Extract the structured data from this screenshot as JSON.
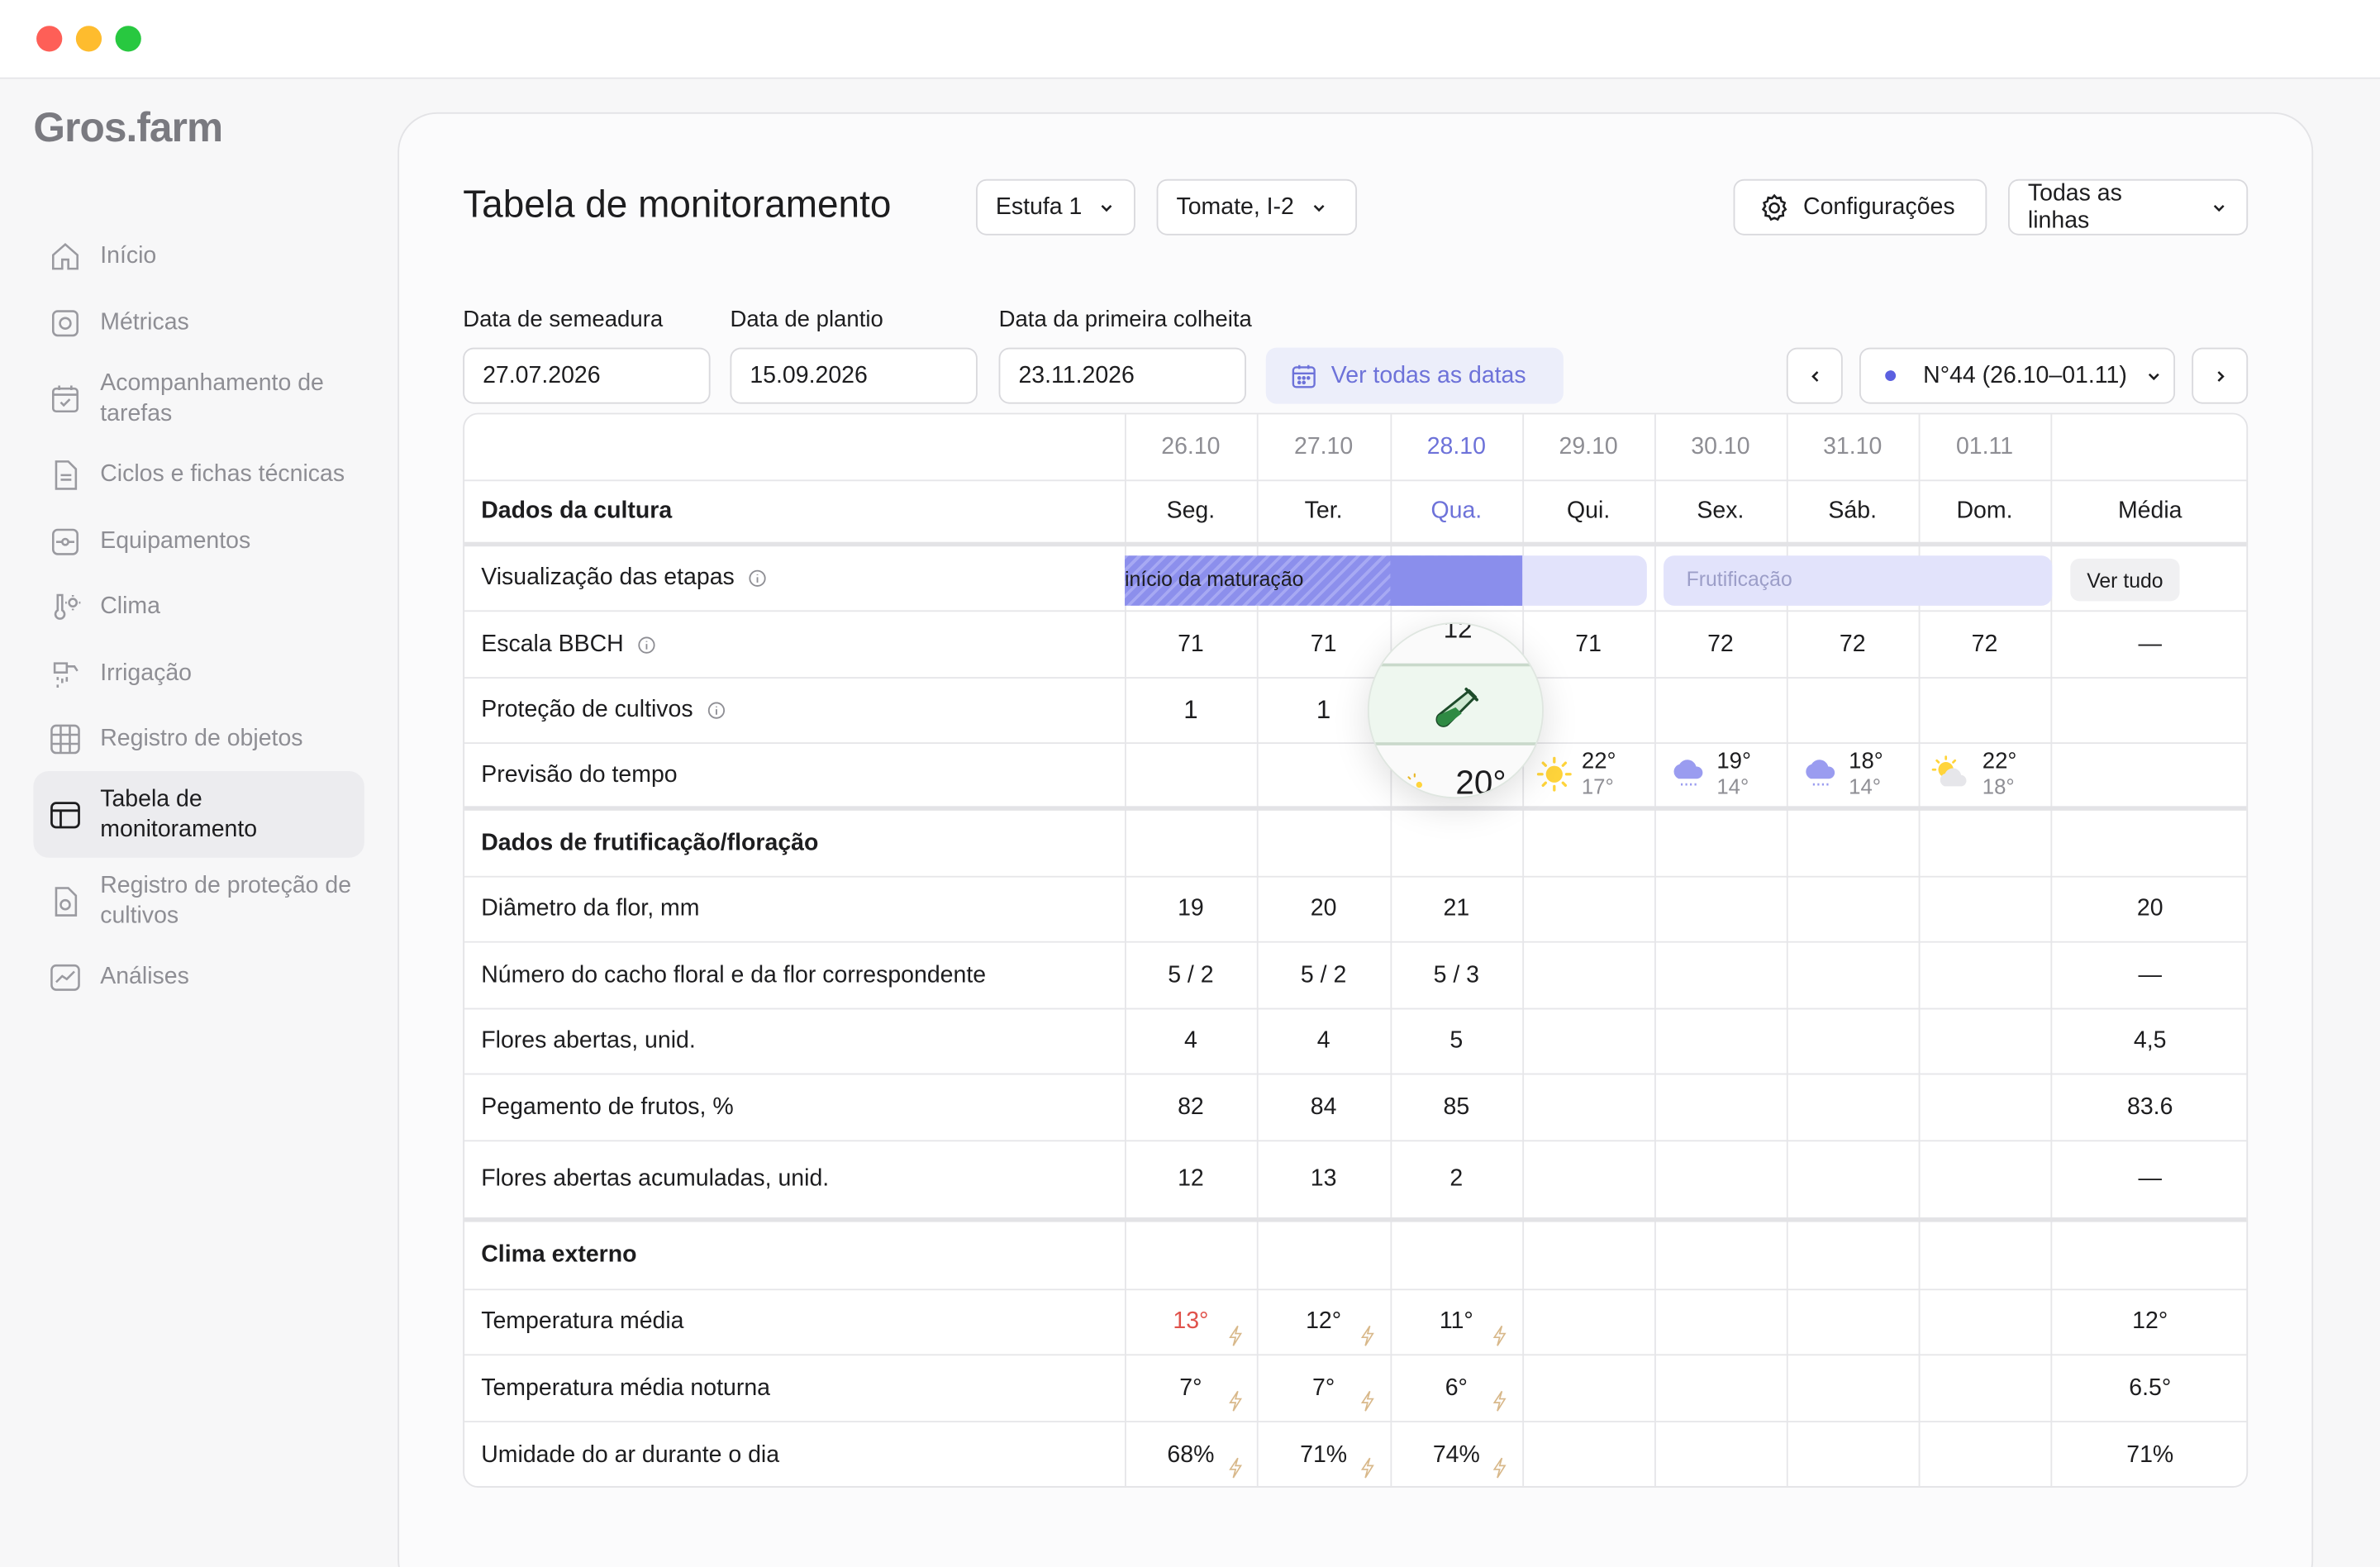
{
  "app": {
    "brand": "Gros.farm"
  },
  "sidebar": {
    "items": [
      {
        "label": "Início",
        "icon": "home-icon"
      },
      {
        "label": "Métricas",
        "icon": "metrics-icon"
      },
      {
        "label": "Acompanhamento de tarefas",
        "icon": "calendar-check-icon"
      },
      {
        "label": "Ciclos e fichas técnicas",
        "icon": "document-icon"
      },
      {
        "label": "Equipamentos",
        "icon": "equipment-icon"
      },
      {
        "label": "Clima",
        "icon": "thermometer-sun-icon"
      },
      {
        "label": "Irrigação",
        "icon": "irrigation-icon"
      },
      {
        "label": "Registro de objetos",
        "icon": "grid-icon"
      },
      {
        "label": "Tabela de monitoramento",
        "icon": "table-icon",
        "active": true
      },
      {
        "label": "Registro de proteção de cultivos",
        "icon": "protection-doc-icon"
      },
      {
        "label": "Análises",
        "icon": "chart-line-icon"
      }
    ]
  },
  "header": {
    "title": "Tabela de monitoramento",
    "greenhouse_select": "Estufa 1",
    "crop_select": "Tomate, I-2",
    "settings_label": "Configurações",
    "lines_select": "Todas as linhas"
  },
  "dates": {
    "sowing_label": "Data de semeadura",
    "sowing_value": "27.07.2026",
    "planting_label": "Data de plantio",
    "planting_value": "15.09.2026",
    "harvest_label": "Data da primeira colheita",
    "harvest_value": "23.11.2026",
    "all_dates_label": "Ver todas as datas",
    "week_select": "N°44 (26.10–01.11)"
  },
  "table": {
    "dates": [
      "26.10",
      "27.10",
      "28.10",
      "29.10",
      "30.10",
      "31.10",
      "01.11"
    ],
    "days": [
      "Seg.",
      "Ter.",
      "Qua.",
      "Qui.",
      "Sex.",
      "Sáb.",
      "Dom."
    ],
    "current_day_index": 2,
    "avg_header": "Média",
    "crop_section": "Dados da cultura",
    "stages_label": "Visualização das etapas",
    "stage_ripening": "início da maturação",
    "stage_fruiting": "Frutificação",
    "see_all": "Ver tudo",
    "bbch_label": "Escala BBCH",
    "bbch_values": [
      "71",
      "71",
      "",
      "71",
      "72",
      "72",
      "72"
    ],
    "bbch_avg": "—",
    "protection_label": "Proteção de cultivos",
    "protection_values": [
      "1",
      "1"
    ],
    "weather_label": "Previsão do tempo",
    "weather": [
      {
        "icon": "sun-icon",
        "hi": "22°",
        "lo": "17°"
      },
      {
        "icon": "rain-cloud-icon",
        "hi": "19°",
        "lo": "14°"
      },
      {
        "icon": "rain-cloud-icon",
        "hi": "18°",
        "lo": "14°"
      },
      {
        "icon": "partly-cloudy-icon",
        "hi": "22°",
        "lo": "18°"
      }
    ],
    "fruit_section": "Dados de frutificação/floração",
    "rows": [
      {
        "label": "Diâmetro da flor, mm",
        "values": [
          "19",
          "20",
          "21"
        ],
        "avg": "20"
      },
      {
        "label": "Número do cacho floral e da flor correspondente",
        "values": [
          "5 / 2",
          "5 / 2",
          "5 / 3"
        ],
        "avg": "—"
      },
      {
        "label": "Flores abertas, unid.",
        "values": [
          "4",
          "4",
          "5"
        ],
        "avg": "4,5"
      },
      {
        "label": "Pegamento de frutos, %",
        "values": [
          "82",
          "84",
          "85"
        ],
        "avg": "83.6"
      },
      {
        "label": "Flores abertas acumuladas, unid.",
        "values": [
          "12",
          "13",
          "2"
        ],
        "avg": "—"
      }
    ],
    "climate_section": "Clima externo",
    "climate_rows": [
      {
        "label": "Temperatura média",
        "values": [
          "13°",
          "12°",
          "11°"
        ],
        "avg": "12°"
      },
      {
        "label": "Temperatura média noturna",
        "values": [
          "7°",
          "7°",
          "6°"
        ],
        "avg": "6.5°"
      },
      {
        "label": "Umidade do ar durante o dia",
        "values": [
          "68%",
          "71%",
          "74%"
        ],
        "avg": "71%"
      }
    ]
  },
  "magnifier": {
    "top_value": "12",
    "bottom_value": "20°",
    "icon": "test-tube-icon"
  },
  "colors": {
    "accent": "#6d72d9",
    "warning": "#e0524b",
    "stage": "#8a8eec",
    "stage_light": "#e2e3fb"
  }
}
